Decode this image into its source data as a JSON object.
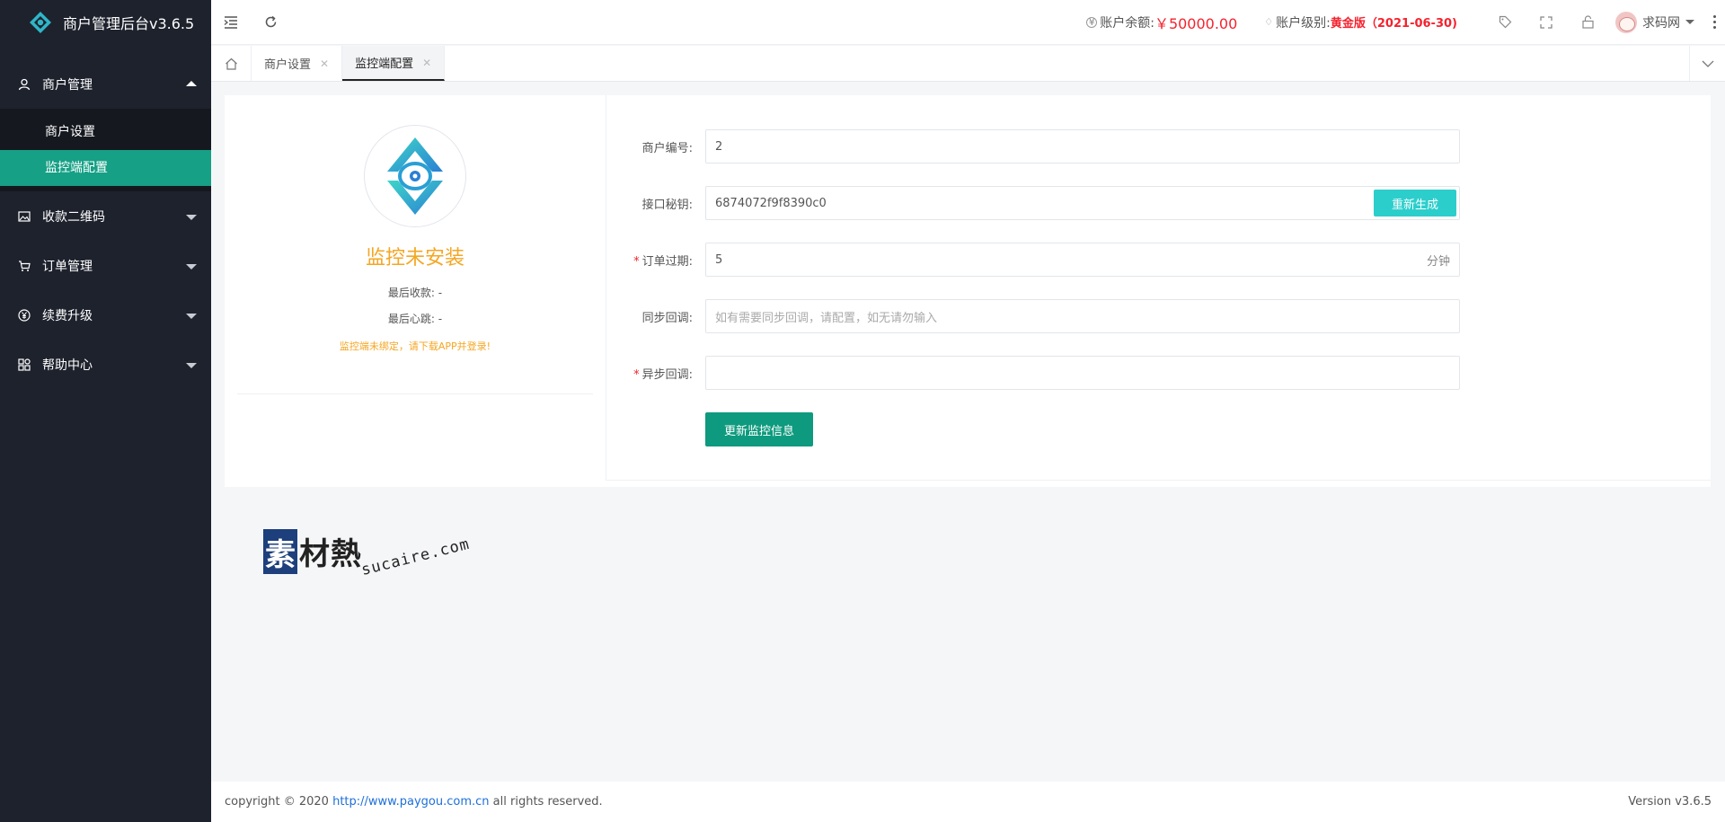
{
  "app": {
    "title": "商户管理后台v3.6.5"
  },
  "sidebar": {
    "groups": [
      {
        "label": "商户管理",
        "icon": "user-icon",
        "expanded": true,
        "children": [
          {
            "label": "商户设置"
          },
          {
            "label": "监控端配置",
            "active": true
          }
        ]
      },
      {
        "label": "收款二维码",
        "icon": "image-icon"
      },
      {
        "label": "订单管理",
        "icon": "cart-icon"
      },
      {
        "label": "续费升级",
        "icon": "yen-icon"
      },
      {
        "label": "帮助中心",
        "icon": "apps-icon"
      }
    ]
  },
  "topbar": {
    "balance_label": "账户余额:",
    "balance_value": "￥50000.00",
    "level_label": "账户级别:",
    "level_value": "黄金版（2021-06-30)",
    "user_name": "求码网"
  },
  "tabs": [
    {
      "label": "商户设置"
    },
    {
      "label": "监控端配置",
      "active": true
    }
  ],
  "status": {
    "title": "监控未安装",
    "last_payment": "最后收款: -",
    "last_heartbeat": "最后心跳: -",
    "warning": "监控端未绑定，请下载APP并登录!"
  },
  "form": {
    "merchant_no": {
      "label": "商户编号:",
      "value": "2"
    },
    "api_key": {
      "label": "接口秘钥:",
      "value": "6874072f9f8390c0",
      "button": "重新生成"
    },
    "order_expire": {
      "label": "订单过期:",
      "value": "5",
      "suffix": "分钟",
      "required": true
    },
    "sync_callback": {
      "label": "同步回调:",
      "placeholder": "如有需要同步回调，请配置，如无请勿输入"
    },
    "async_callback": {
      "label": "异步回调:",
      "value": "",
      "required": true
    },
    "submit": "更新监控信息"
  },
  "watermark": {
    "brand_first": "素",
    "brand_rest": "材熱",
    "url": "sucaire.com"
  },
  "footer": {
    "copyright": "copyright © 2020",
    "link": "http://www.paygou.com.cn",
    "rights": "all rights reserved.",
    "version": "Version v3.6.5"
  },
  "colors": {
    "sidebar_bg": "#1e222d",
    "active": "#16a085",
    "accent": "#2ccecc",
    "warn": "#f5a623",
    "danger": "#f5222d"
  }
}
